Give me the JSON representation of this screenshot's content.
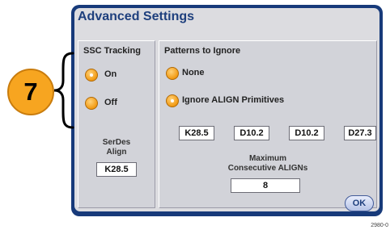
{
  "dialog": {
    "title": "Advanced Settings",
    "ok_label": "OK"
  },
  "ssc_tracking": {
    "title": "SSC Tracking",
    "options": [
      {
        "label": "On",
        "selected": true
      },
      {
        "label": "Off",
        "selected": false
      }
    ]
  },
  "serdes_align": {
    "label_line1": "SerDes",
    "label_line2": "Align",
    "value": "K28.5"
  },
  "patterns_to_ignore": {
    "title": "Patterns to Ignore",
    "options": [
      {
        "label": "None",
        "selected": false
      },
      {
        "label": "Ignore ALIGN Primitives",
        "selected": true
      }
    ],
    "primitives": [
      "K28.5",
      "D10.2",
      "D10.2",
      "D27.3"
    ],
    "max_label_line1": "Maximum",
    "max_label_line2": "Consecutive ALIGNs",
    "max_value": "8"
  },
  "callout": {
    "number": "7"
  },
  "watermark": "2980-0",
  "icons": {
    "radio": "radio-button-icon",
    "brace": "curly-brace-icon"
  },
  "colors": {
    "frame": "#173a7a",
    "radio": "#f29a12",
    "callout": "#f7a520"
  }
}
